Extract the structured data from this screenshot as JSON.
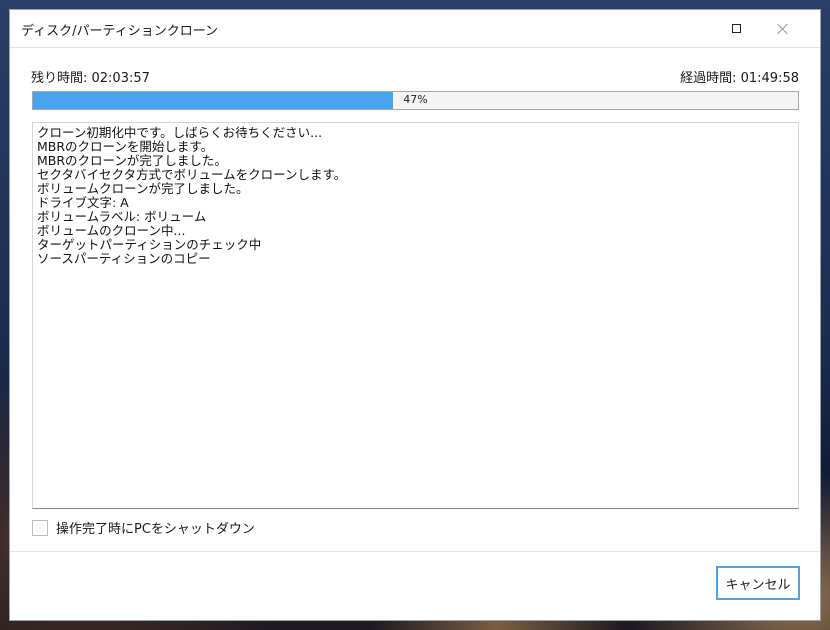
{
  "window": {
    "title": "ディスク/パーティションクローン"
  },
  "status": {
    "remaining_label": "残り時間: 02:03:57",
    "elapsed_label": "経過時間: 01:49:58"
  },
  "progress": {
    "percent": 47,
    "label": "47%",
    "fill_color": "#4aa3ee"
  },
  "log": {
    "lines": [
      "クローン初期化中です。しばらくお待ちください...",
      "MBRのクローンを開始します。",
      "MBRのクローンが完了しました。",
      "セクタバイセクタ方式でボリュームをクローンします。",
      "ボリュームクローンが完了しました。",
      "ドライブ文字: A",
      "ボリュームラベル: ボリューム",
      "ボリュームのクローン中...",
      "ターゲットパーティションのチェック中",
      "ソースパーティションのコピー"
    ]
  },
  "options": {
    "shutdown_label": "操作完了時にPCをシャットダウン",
    "shutdown_checked": false
  },
  "buttons": {
    "cancel_label": "キャンセル"
  },
  "icons": {
    "maximize": "maximize-icon",
    "close": "close-icon"
  }
}
